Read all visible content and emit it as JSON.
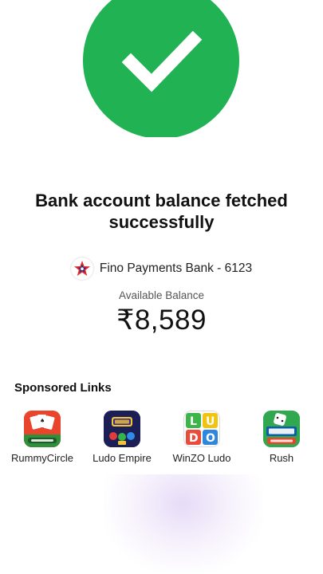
{
  "status": {
    "title": "Bank account balance fetched successfully"
  },
  "bank": {
    "name": "Fino Payments Bank - 6123",
    "logo_icon": "fino-star-icon"
  },
  "balance": {
    "label": "Available Balance",
    "amount": "₹8,589"
  },
  "sponsored": {
    "title": "Sponsored Links",
    "apps": [
      {
        "label": "RummyCircle",
        "icon": "rummycircle-app-icon"
      },
      {
        "label": "Ludo Empire",
        "icon": "ludo-empire-app-icon"
      },
      {
        "label": "WinZO Ludo",
        "icon": "winzo-ludo-app-icon"
      },
      {
        "label": "Rush",
        "icon": "rush-app-icon"
      }
    ]
  },
  "colors": {
    "success_green": "#21b254",
    "fino_blue": "#1d2f8a",
    "fino_red": "#e32b2b"
  }
}
